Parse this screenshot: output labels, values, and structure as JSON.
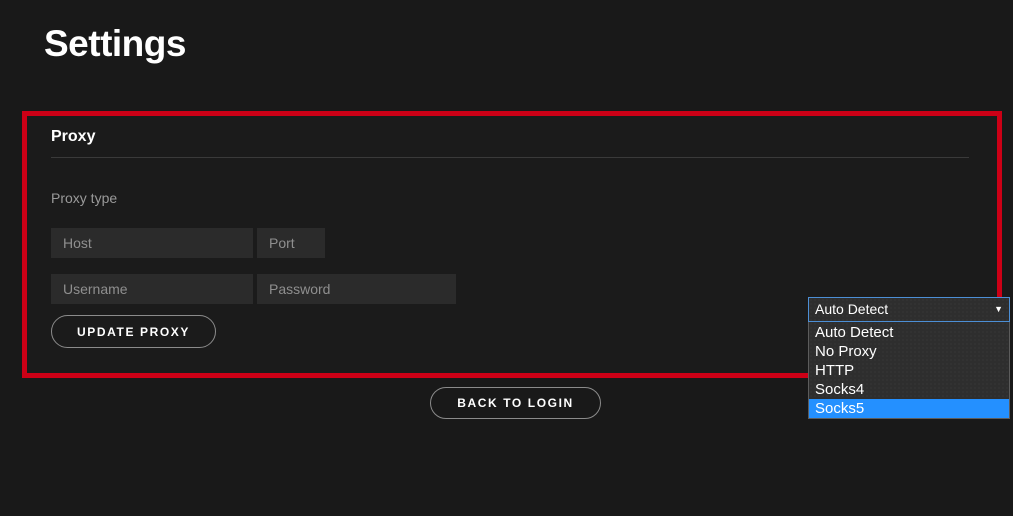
{
  "page": {
    "title": "Settings",
    "background_color": "#191919"
  },
  "highlight": {
    "border_color": "#cc0016",
    "border_width_px": 5
  },
  "proxy_section": {
    "title": "Proxy",
    "proxy_type_label": "Proxy type",
    "inputs": {
      "host_placeholder": "Host",
      "port_placeholder": "Port",
      "username_placeholder": "Username",
      "password_placeholder": "Password"
    },
    "update_button_label": "Update Proxy",
    "proxy_type_select": {
      "selected_value": "Auto Detect",
      "expanded": true,
      "arrow_icon": "▼",
      "highlight_color": "#2490ff",
      "focus_border_color": "#4c8fd6",
      "options": [
        {
          "label": "Auto Detect",
          "highlighted": false
        },
        {
          "label": "No Proxy",
          "highlighted": false
        },
        {
          "label": "HTTP",
          "highlighted": false
        },
        {
          "label": "Socks4",
          "highlighted": false
        },
        {
          "label": "Socks5",
          "highlighted": true
        }
      ]
    }
  },
  "footer": {
    "back_button_label": "Back to Login"
  }
}
